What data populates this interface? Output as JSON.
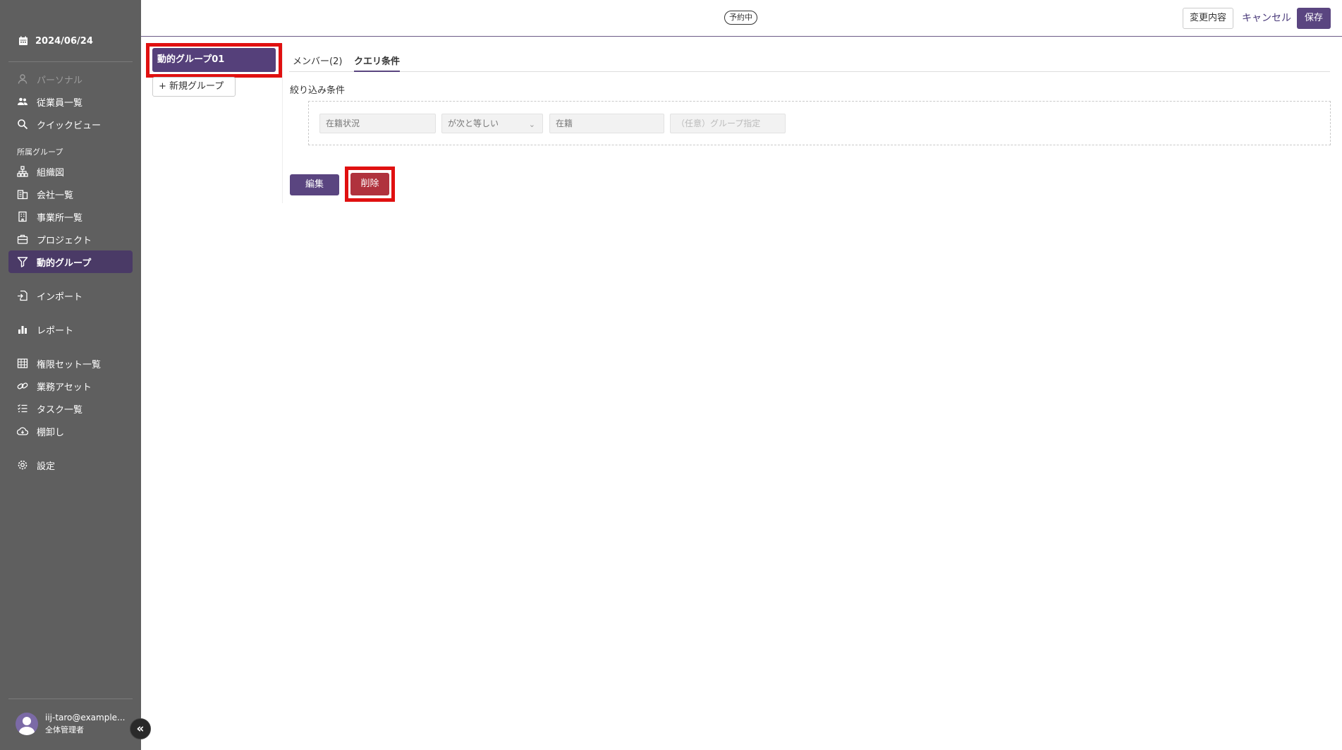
{
  "sidebar": {
    "date": "2024/06/24",
    "items_top": [
      {
        "label": "パーソナル",
        "icon": "person-icon"
      },
      {
        "label": "従業員一覧",
        "icon": "people-icon"
      },
      {
        "label": "クイックビュー",
        "icon": "search-icon"
      }
    ],
    "section_label": "所属グループ",
    "items_group": [
      {
        "label": "組織図",
        "icon": "org-chart-icon"
      },
      {
        "label": "会社一覧",
        "icon": "building-icon"
      },
      {
        "label": "事業所一覧",
        "icon": "office-icon"
      },
      {
        "label": "プロジェクト",
        "icon": "briefcase-icon"
      },
      {
        "label": "動的グループ",
        "icon": "filter-icon"
      }
    ],
    "item_import": {
      "label": "インポート",
      "icon": "import-icon"
    },
    "item_report": {
      "label": "レポート",
      "icon": "bar-chart-icon"
    },
    "items_admin": [
      {
        "label": "権限セット一覧",
        "icon": "grid-icon"
      },
      {
        "label": "業務アセット",
        "icon": "link-icon"
      },
      {
        "label": "タスク一覧",
        "icon": "task-list-icon"
      },
      {
        "label": "棚卸し",
        "icon": "cloud-icon"
      }
    ],
    "item_settings": {
      "label": "設定",
      "icon": "gear-icon"
    },
    "user": {
      "email": "iij-taro@example...",
      "role": "全体管理者"
    },
    "collapse_glyph": "«"
  },
  "header": {
    "status": "予約中",
    "changes_label": "変更内容",
    "cancel_label": "キャンセル",
    "save_label": "保存"
  },
  "groups": {
    "selected": "動的グループ01",
    "new_group_label": "+ 新規グループ"
  },
  "tabs": [
    {
      "label": "メンバー(2)",
      "active": false
    },
    {
      "label": "クエリ条件",
      "active": true
    }
  ],
  "filter": {
    "title": "絞り込み条件",
    "field1": "在籍状況",
    "operator": "が次と等しい",
    "value": "在籍",
    "group_placeholder": "（任意）グループ指定"
  },
  "actions": {
    "edit_label": "編集",
    "delete_label": "削除"
  },
  "colors": {
    "sidebar_bg": "#5f5f5f",
    "accent": "#5a4580",
    "delete": "#b0323d",
    "highlight": "#e01010"
  }
}
